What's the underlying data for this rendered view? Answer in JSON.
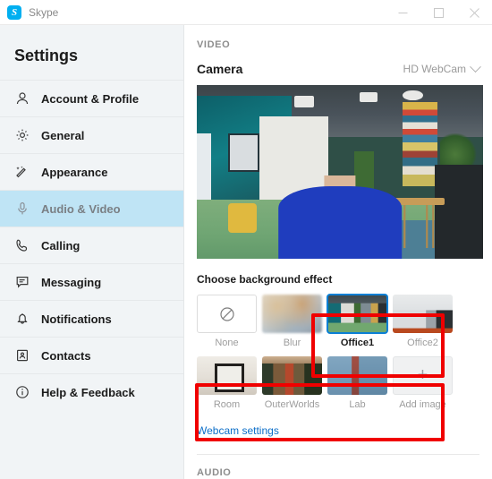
{
  "titlebar": {
    "app_name": "Skype",
    "logo_letter": "S",
    "minimize_label": "Minimize",
    "maximize_label": "Maximize",
    "close_label": "Close"
  },
  "sidebar": {
    "heading": "Settings",
    "items": [
      {
        "label": "Account & Profile",
        "icon": "person-icon",
        "selected": false
      },
      {
        "label": "General",
        "icon": "gear-icon",
        "selected": false
      },
      {
        "label": "Appearance",
        "icon": "magic-wand-icon",
        "selected": false
      },
      {
        "label": "Audio & Video",
        "icon": "microphone-icon",
        "selected": true
      },
      {
        "label": "Calling",
        "icon": "phone-icon",
        "selected": false
      },
      {
        "label": "Messaging",
        "icon": "chat-bubble-icon",
        "selected": false
      },
      {
        "label": "Notifications",
        "icon": "bell-icon",
        "selected": false
      },
      {
        "label": "Contacts",
        "icon": "contact-card-icon",
        "selected": false
      },
      {
        "label": "Help & Feedback",
        "icon": "info-circle-icon",
        "selected": false
      }
    ]
  },
  "content": {
    "video_section_header": "VIDEO",
    "camera_label": "Camera",
    "camera_device": "HD WebCam",
    "background_effect_title": "Choose background effect",
    "background_effects_row1": [
      {
        "label": "None",
        "type": "none",
        "selected": false
      },
      {
        "label": "Blur",
        "type": "blur",
        "selected": false
      },
      {
        "label": "Office1",
        "type": "image",
        "selected": true
      },
      {
        "label": "Office2",
        "type": "image",
        "selected": false
      }
    ],
    "background_effects_row2": [
      {
        "label": "Room",
        "type": "image",
        "selected": false
      },
      {
        "label": "OuterWorlds",
        "type": "image",
        "selected": false
      },
      {
        "label": "Lab",
        "type": "image",
        "selected": false
      },
      {
        "label": "Add image",
        "type": "add",
        "selected": false
      }
    ],
    "webcam_settings_link": "Webcam settings",
    "audio_section_header": "AUDIO"
  },
  "colors": {
    "accent_blue": "#0a7fd4",
    "link_blue": "#0b6ec8",
    "selected_nav_bg": "#bfe4f5",
    "annotation_red": "#f00000",
    "sidebar_bg": "#f1f4f6"
  }
}
